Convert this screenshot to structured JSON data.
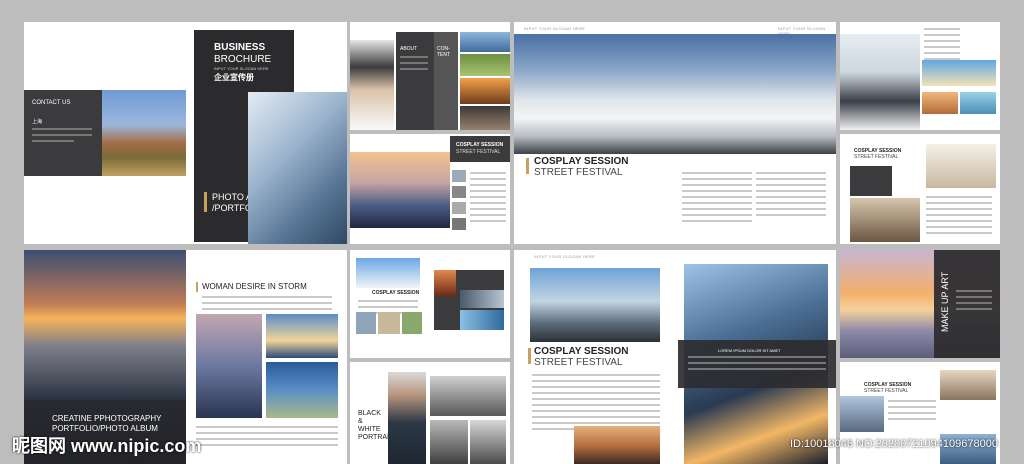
{
  "cover": {
    "title_line1": "BUSINESS",
    "title_line2": "BROCHURE",
    "slogan": "INPUT YOUR SLOGAN HERE",
    "title_cn": "企业宣传册",
    "photo_album": "PHOTO ALBUM",
    "portfolio": "/PORTFOLIO"
  },
  "contact": {
    "label": "CONTACT US",
    "city": "上海"
  },
  "about": {
    "label": "ABOUT",
    "content_label_1": "CON-",
    "content_label_2": "TENT"
  },
  "header_slogan": "INPUT YOUR SLOGAN HERE",
  "cosplay": {
    "title": "COSPLAY SESSION",
    "subtitle": "STREET FESTIVAL"
  },
  "woman": {
    "title": "WOMAN DESIRE IN STORM"
  },
  "creatine": {
    "line1": "CREATINE PPHOTOGRAPHY",
    "line2": "PORTFOLIO/PHOTO ALBUM"
  },
  "black_white": {
    "line1": "BLACK",
    "line2": "&",
    "line3": "WHITE",
    "line4": "PORTRAIT"
  },
  "creatie_label": "CREATIE PPHOTOGRAPHY",
  "lorem_label": "LOREM IPSUM DOLOR SIT AMET",
  "make_up": "MAKE UP ART",
  "watermark": {
    "site": "昵图网 www.nipic.com",
    "id": "ID:10018046 NO:20200721094109678000"
  }
}
